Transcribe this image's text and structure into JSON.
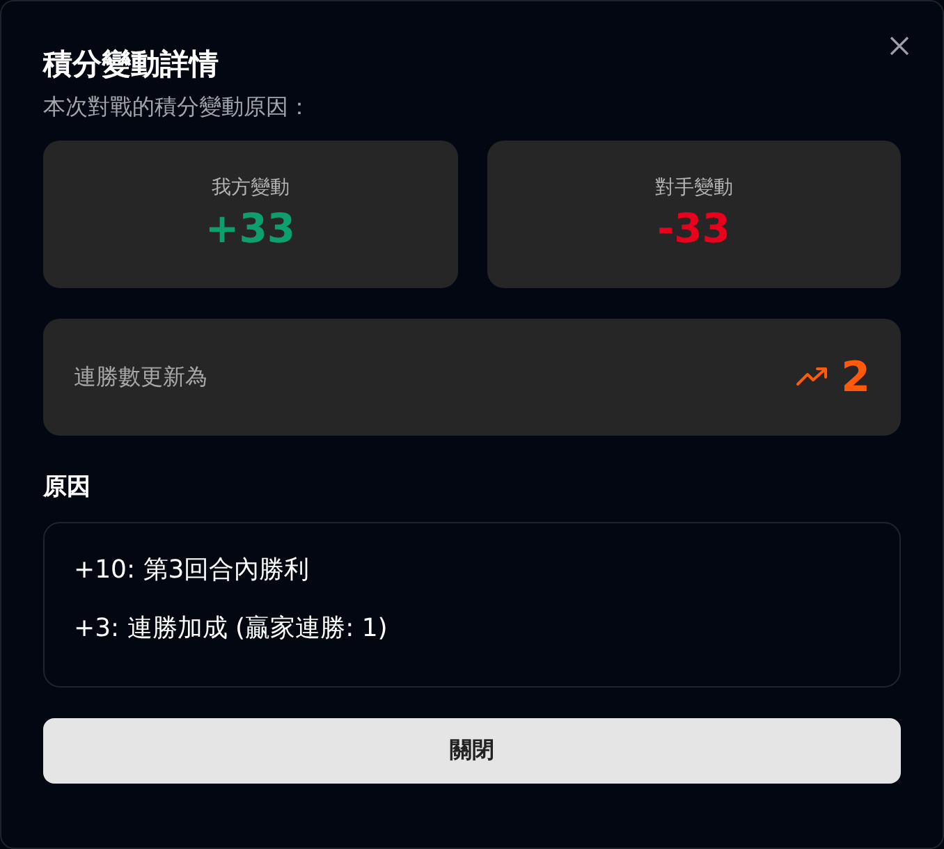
{
  "dialog": {
    "title": "積分變動詳情",
    "subtitle": "本次對戰的積分變動原因："
  },
  "changes": [
    {
      "label": "我方變動",
      "value": "+33",
      "kind": "gain"
    },
    {
      "label": "對手變動",
      "value": "-33",
      "kind": "loss"
    }
  ],
  "streak": {
    "label": "連勝數更新為",
    "value": "2"
  },
  "reasons": {
    "heading": "原因",
    "items": [
      "+10: 第3回合內勝利",
      "+3: 連勝加成 (贏家連勝: 1)"
    ]
  },
  "buttons": [
    "關閉"
  ]
}
